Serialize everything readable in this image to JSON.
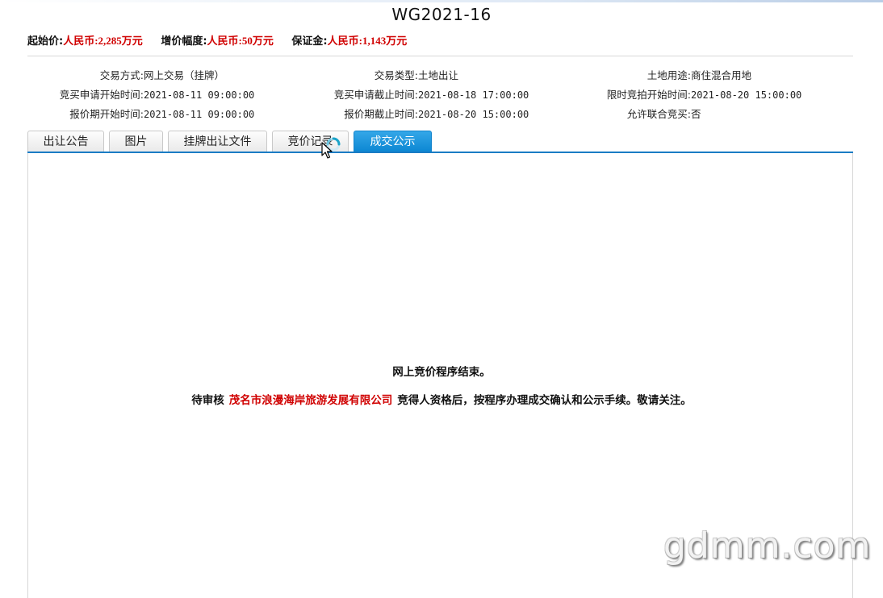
{
  "page": {
    "title": "WG2021-16"
  },
  "price_bar": {
    "start_price_label": "起始价:",
    "start_price_value": "人民币:2,285万元",
    "increment_label": "增价幅度:",
    "increment_value": "人民币:50万元",
    "deposit_label": "保证金:",
    "deposit_value": "人民币:1,143万元"
  },
  "info": {
    "trade_method_label": "交易方式:",
    "trade_method_value": "网上交易（挂牌）",
    "trade_type_label": "交易类型:",
    "trade_type_value": "土地出让",
    "land_use_label": "土地用途:",
    "land_use_value": "商住混合用地",
    "apply_start_label": "竞买申请开始时间:",
    "apply_start_value": "2021-08-11 09:00:00",
    "apply_end_label": "竞买申请截止时间:",
    "apply_end_value": "2021-08-18 17:00:00",
    "timed_bid_start_label": "限时竞拍开始时间:",
    "timed_bid_start_value": "2021-08-20 15:00:00",
    "quote_start_label": "报价期开始时间:",
    "quote_start_value": "2021-08-11 09:00:00",
    "quote_end_label": "报价期截止时间:",
    "quote_end_value": "2021-08-20 15:00:00",
    "joint_bid_label": "允许联合竞买:",
    "joint_bid_value": "否"
  },
  "tabs": [
    {
      "label": "出让公告",
      "active": false
    },
    {
      "label": "图片",
      "active": false
    },
    {
      "label": "挂牌出让文件",
      "active": false
    },
    {
      "label": "竞价记录",
      "active": false
    },
    {
      "label": "成交公示",
      "active": true
    }
  ],
  "content": {
    "ended_message": "网上竞价程序结束。",
    "pending_prefix": "待审核",
    "winner_name": "茂名市浪漫海岸旅游发展有限公司",
    "pending_suffix": "竞得人资格后，按程序办理成交确认和公示手续。敬请关注。"
  },
  "watermark": "gdmm.com",
  "colors": {
    "accent_red": "#d00000",
    "tab_active": "#1a8ad6",
    "tab_line": "#1a7cc4"
  },
  "icons": {
    "spinner": "loading-spinner-icon",
    "cursor": "mouse-pointer-icon"
  }
}
